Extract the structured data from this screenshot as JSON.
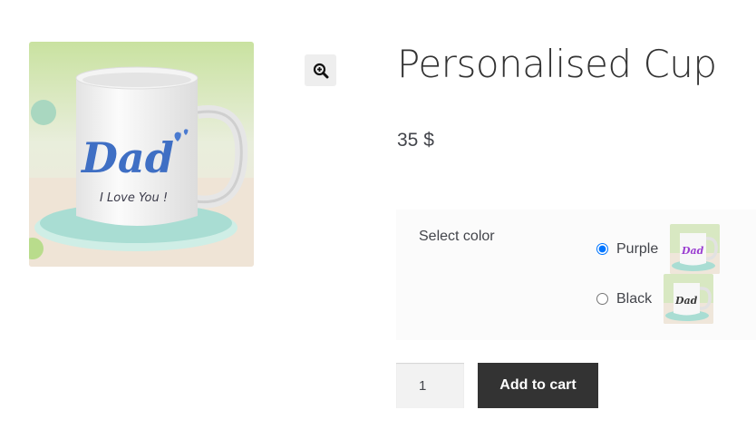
{
  "product": {
    "title": "Personalised Cup",
    "price": "35 $",
    "image_text_main": "Dad",
    "image_text_sub": "I Love You !"
  },
  "zoom": {
    "icon": "zoom-in-icon"
  },
  "variations": {
    "label": "Select color",
    "options": [
      {
        "label": "Purple",
        "selected": true,
        "color": "#9b3fd1"
      },
      {
        "label": "Black",
        "selected": false,
        "color": "#3a3a3a"
      }
    ]
  },
  "cart": {
    "quantity": "1",
    "add_label": "Add to cart"
  },
  "colors": {
    "button_bg": "#333333",
    "mug_text_blue": "#3f6fc4",
    "saucer": "#a8ddd4",
    "background_green": "#c7dfa0"
  }
}
